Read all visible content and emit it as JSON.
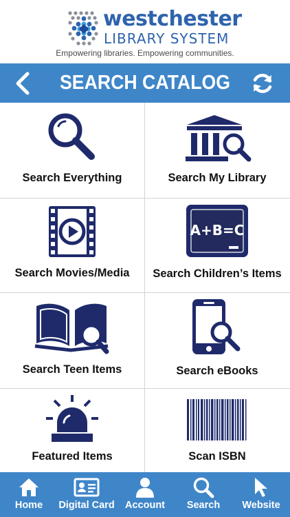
{
  "brand": {
    "name_line1": "westchester",
    "name_line2": "LIBRARY SYSTEM",
    "tagline": "Empowering libraries. Empowering communities."
  },
  "titlebar": {
    "title": "SEARCH CATALOG"
  },
  "grid": {
    "items": [
      {
        "label": "Search Everything",
        "icon": "magnifier-icon"
      },
      {
        "label": "Search My Library",
        "icon": "library-building-icon"
      },
      {
        "label": "Search Movies/Media",
        "icon": "film-play-icon"
      },
      {
        "label": "Search Children’s Items",
        "icon": "chalkboard-icon"
      },
      {
        "label": "Search Teen Items",
        "icon": "open-book-icon"
      },
      {
        "label": "Search eBooks",
        "icon": "phone-search-icon"
      },
      {
        "label": "Featured Items",
        "icon": "siren-light-icon"
      },
      {
        "label": "Scan ISBN",
        "icon": "barcode-icon"
      }
    ],
    "chalkboard_text": "A+B=C"
  },
  "tabbar": {
    "tabs": [
      {
        "label": "Home",
        "icon": "home-icon"
      },
      {
        "label": "Digital Card",
        "icon": "id-card-icon"
      },
      {
        "label": "Account",
        "icon": "person-icon"
      },
      {
        "label": "Search",
        "icon": "search-icon"
      },
      {
        "label": "Website",
        "icon": "cursor-arrow-icon"
      }
    ]
  },
  "colors": {
    "accent": "#3f86c9",
    "icon_navy": "#1f2a6b",
    "brand_blue": "#2f63ad"
  }
}
